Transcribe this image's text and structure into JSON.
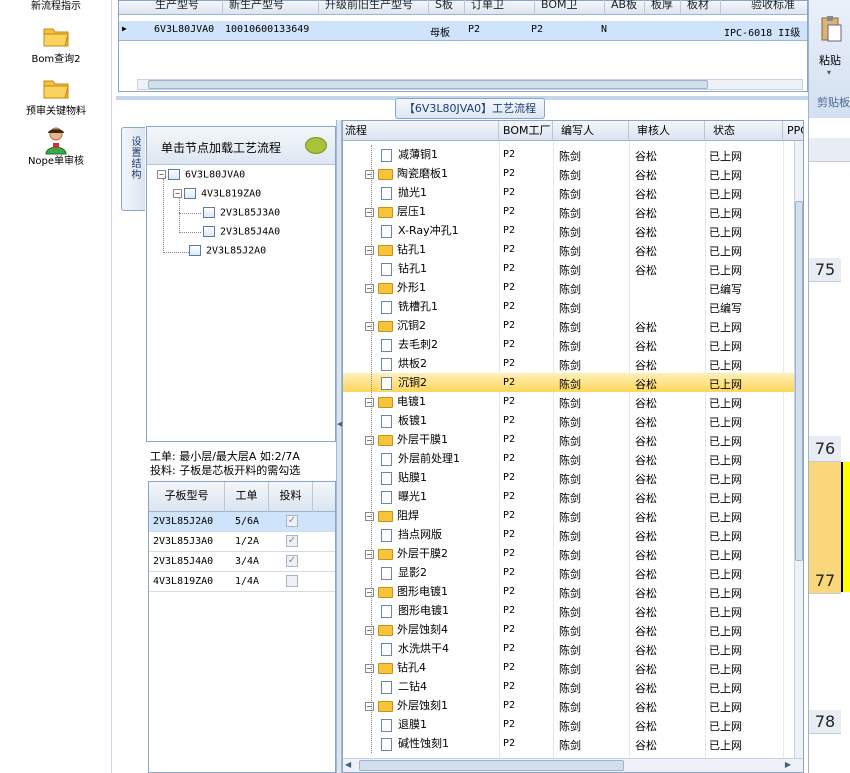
{
  "launcher": {
    "items": [
      {
        "label": "新流程指示"
      },
      {
        "label": "Bom查询2"
      },
      {
        "label": "预审关键物料"
      },
      {
        "label": "Nope单审核"
      }
    ]
  },
  "top_grid": {
    "headers": [
      "生产型号",
      "新生产型号",
      "升级前旧生产型号",
      "S板",
      "订单卫",
      "BOM卫",
      "AB板",
      "板厚",
      "板材",
      "验收标准"
    ],
    "row": [
      "6V3L80JVA0",
      "10010600133649",
      "母板",
      "P2",
      "P2",
      "N",
      "IPC-6018 II级"
    ]
  },
  "ribbon": {
    "paste": "粘贴",
    "clipboard": "剪贴板"
  },
  "excel_rows": [
    "75",
    "76",
    "77",
    "78"
  ],
  "flow_tab": "【6V3L80JVA0】工艺流程",
  "vertical_tab": "设置结构",
  "tree": {
    "header": "单击节点加载工艺流程",
    "nodes": [
      "6V3L80JVA0",
      "4V3L819ZA0",
      "2V3L85J3A0",
      "2V3L85J4A0",
      "2V3L85J2A0"
    ]
  },
  "info": {
    "line1": "工单: 最小层/最大层A 如:2/7A",
    "line2": "投料: 子板是芯板开料的需勾选"
  },
  "sub_table": {
    "headers": [
      "子板型号",
      "工单",
      "投料"
    ],
    "rows": [
      {
        "model": "2V3L85J2A0",
        "order": "5/6A",
        "checked": true
      },
      {
        "model": "2V3L85J3A0",
        "order": "1/2A",
        "checked": true
      },
      {
        "model": "2V3L85J4A0",
        "order": "3/4A",
        "checked": true
      },
      {
        "model": "4V3L819ZA0",
        "order": "1/4A",
        "checked": false
      }
    ]
  },
  "main_grid": {
    "headers": [
      "流程",
      "BOM工厂",
      "编写人",
      "审核人",
      "状态",
      "PPC"
    ],
    "rows": [
      {
        "name": "减薄铜1",
        "child": true,
        "bom": "P2",
        "writer": "陈剑",
        "reviewer": "谷松",
        "status": "已上网"
      },
      {
        "name": "陶瓷磨板1",
        "child": false,
        "bom": "P2",
        "writer": "陈剑",
        "reviewer": "谷松",
        "status": "已上网"
      },
      {
        "name": "抛光1",
        "child": true,
        "bom": "P2",
        "writer": "陈剑",
        "reviewer": "谷松",
        "status": "已上网"
      },
      {
        "name": "层压1",
        "child": false,
        "bom": "P2",
        "writer": "陈剑",
        "reviewer": "谷松",
        "status": "已上网"
      },
      {
        "name": "X-Ray冲孔1",
        "child": true,
        "bom": "P2",
        "writer": "陈剑",
        "reviewer": "谷松",
        "status": "已上网"
      },
      {
        "name": "钻孔1",
        "child": false,
        "bom": "P2",
        "writer": "陈剑",
        "reviewer": "谷松",
        "status": "已上网"
      },
      {
        "name": "钻孔1",
        "child": true,
        "bom": "P2",
        "writer": "陈剑",
        "reviewer": "谷松",
        "status": "已上网"
      },
      {
        "name": "外形1",
        "child": false,
        "bom": "P2",
        "writer": "陈剑",
        "reviewer": "",
        "status": "已编写"
      },
      {
        "name": "铣槽孔1",
        "child": true,
        "bom": "P2",
        "writer": "陈剑",
        "reviewer": "",
        "status": "已编写"
      },
      {
        "name": "沉铜2",
        "child": false,
        "bom": "P2",
        "writer": "陈剑",
        "reviewer": "谷松",
        "status": "已上网"
      },
      {
        "name": "去毛刺2",
        "child": true,
        "bom": "P2",
        "writer": "陈剑",
        "reviewer": "谷松",
        "status": "已上网"
      },
      {
        "name": "烘板2",
        "child": true,
        "bom": "P2",
        "writer": "陈剑",
        "reviewer": "谷松",
        "status": "已上网"
      },
      {
        "name": "沉铜2",
        "child": true,
        "bom": "P2",
        "writer": "陈剑",
        "reviewer": "谷松",
        "status": "已上网",
        "selected": true
      },
      {
        "name": "电镀1",
        "child": false,
        "bom": "P2",
        "writer": "陈剑",
        "reviewer": "谷松",
        "status": "已上网"
      },
      {
        "name": "板镀1",
        "child": true,
        "bom": "P2",
        "writer": "陈剑",
        "reviewer": "谷松",
        "status": "已上网"
      },
      {
        "name": "外层干膜1",
        "child": false,
        "bom": "P2",
        "writer": "陈剑",
        "reviewer": "谷松",
        "status": "已上网"
      },
      {
        "name": "外层前处理1",
        "child": true,
        "bom": "P2",
        "writer": "陈剑",
        "reviewer": "谷松",
        "status": "已上网"
      },
      {
        "name": "贴膜1",
        "child": true,
        "bom": "P2",
        "writer": "陈剑",
        "reviewer": "谷松",
        "status": "已上网"
      },
      {
        "name": "曝光1",
        "child": true,
        "bom": "P2",
        "writer": "陈剑",
        "reviewer": "谷松",
        "status": "已上网"
      },
      {
        "name": "阻焊",
        "child": false,
        "bom": "P2",
        "writer": "陈剑",
        "reviewer": "谷松",
        "status": "已上网"
      },
      {
        "name": "挡点网版",
        "child": true,
        "bom": "P2",
        "writer": "陈剑",
        "reviewer": "谷松",
        "status": "已上网"
      },
      {
        "name": "外层干膜2",
        "child": false,
        "bom": "P2",
        "writer": "陈剑",
        "reviewer": "谷松",
        "status": "已上网"
      },
      {
        "name": "显影2",
        "child": true,
        "bom": "P2",
        "writer": "陈剑",
        "reviewer": "谷松",
        "status": "已上网"
      },
      {
        "name": "图形电镀1",
        "child": false,
        "bom": "P2",
        "writer": "陈剑",
        "reviewer": "谷松",
        "status": "已上网"
      },
      {
        "name": "图形电镀1",
        "child": true,
        "bom": "P2",
        "writer": "陈剑",
        "reviewer": "谷松",
        "status": "已上网"
      },
      {
        "name": "外层蚀刻4",
        "child": false,
        "bom": "P2",
        "writer": "陈剑",
        "reviewer": "谷松",
        "status": "已上网"
      },
      {
        "name": "水洗烘干4",
        "child": true,
        "bom": "P2",
        "writer": "陈剑",
        "reviewer": "谷松",
        "status": "已上网"
      },
      {
        "name": "钻孔4",
        "child": false,
        "bom": "P2",
        "writer": "陈剑",
        "reviewer": "谷松",
        "status": "已上网"
      },
      {
        "name": "二钻4",
        "child": true,
        "bom": "P2",
        "writer": "陈剑",
        "reviewer": "谷松",
        "status": "已上网"
      },
      {
        "name": "外层蚀刻1",
        "child": false,
        "bom": "P2",
        "writer": "陈剑",
        "reviewer": "谷松",
        "status": "已上网"
      },
      {
        "name": "退膜1",
        "child": true,
        "bom": "P2",
        "writer": "陈剑",
        "reviewer": "谷松",
        "status": "已上网"
      },
      {
        "name": "碱性蚀刻1",
        "child": true,
        "bom": "P2",
        "writer": "陈剑",
        "reviewer": "谷松",
        "status": "已上网"
      }
    ]
  }
}
